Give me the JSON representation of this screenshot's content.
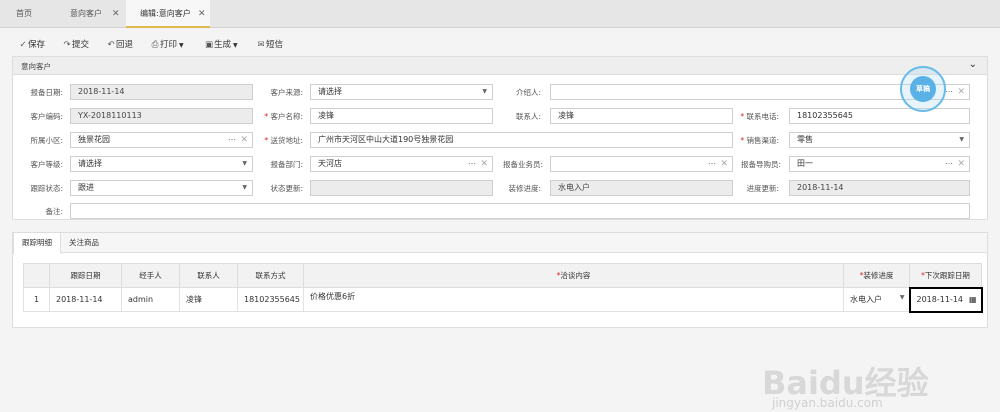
{
  "tabs": [
    {
      "label": "首页"
    },
    {
      "label": "意向客户",
      "close": "✕"
    },
    {
      "label": "编辑:意向客户",
      "close": "✕"
    }
  ],
  "toolbar": {
    "save": "保存",
    "submit": "提交",
    "revert": "回退",
    "print": "打印",
    "generate": "生成",
    "sms": "短信"
  },
  "panel": {
    "title": "意向客户"
  },
  "form": {
    "report_date_label": "报备日期:",
    "report_date": "2018-11-14",
    "source_label": "客户来源:",
    "source": "请选择",
    "referrer_label": "介绍人:",
    "referrer": "",
    "code_label": "客户编码:",
    "code": "YX-2018110113",
    "name_label": "客户名称:",
    "name": "凌锋",
    "contact_label": "联系人:",
    "contact": "凌锋",
    "phone_label": "联系电话:",
    "phone": "18102355645",
    "community_label": "所属小区:",
    "community": "独景花园",
    "address_label": "送货地址:",
    "address": "广州市天河区中山大道190号独景花园",
    "channel_label": "销售渠道:",
    "channel": "零售",
    "level_label": "客户等级:",
    "level": "请选择",
    "dept_label": "报备部门:",
    "dept": "天河店",
    "salesman_label": "报备业务员:",
    "salesman": "",
    "guide_label": "报备导购员:",
    "guide": "田一",
    "follow_status_label": "跟踪状态:",
    "follow_status": "跟进",
    "status_update_label": "状态更新:",
    "status_update": "",
    "decor_progress_label": "装修进度:",
    "decor_progress": "水电入户",
    "progress_update_label": "进度更新:",
    "progress_update": "2018-11-14",
    "remark_label": "备注:",
    "remark": ""
  },
  "subtabs": [
    {
      "label": "跟踪明细"
    },
    {
      "label": "关注商品"
    }
  ],
  "grid": {
    "headers": [
      "",
      "跟踪日期",
      "经手人",
      "联系人",
      "联系方式",
      "洽谈内容",
      "装修进度",
      "下次跟踪日期"
    ],
    "rows": [
      {
        "index": "1",
        "date": "2018-11-14",
        "handler": "admin",
        "contact": "凌锋",
        "phone": "18102355645",
        "content": "价格优惠6折",
        "progress": "水电入户",
        "next_date": "2018-11-14"
      }
    ]
  },
  "stamp": {
    "text": "草稿"
  },
  "watermark": {
    "brand": "Baidu经验",
    "url": "jingyan.baidu.com"
  }
}
